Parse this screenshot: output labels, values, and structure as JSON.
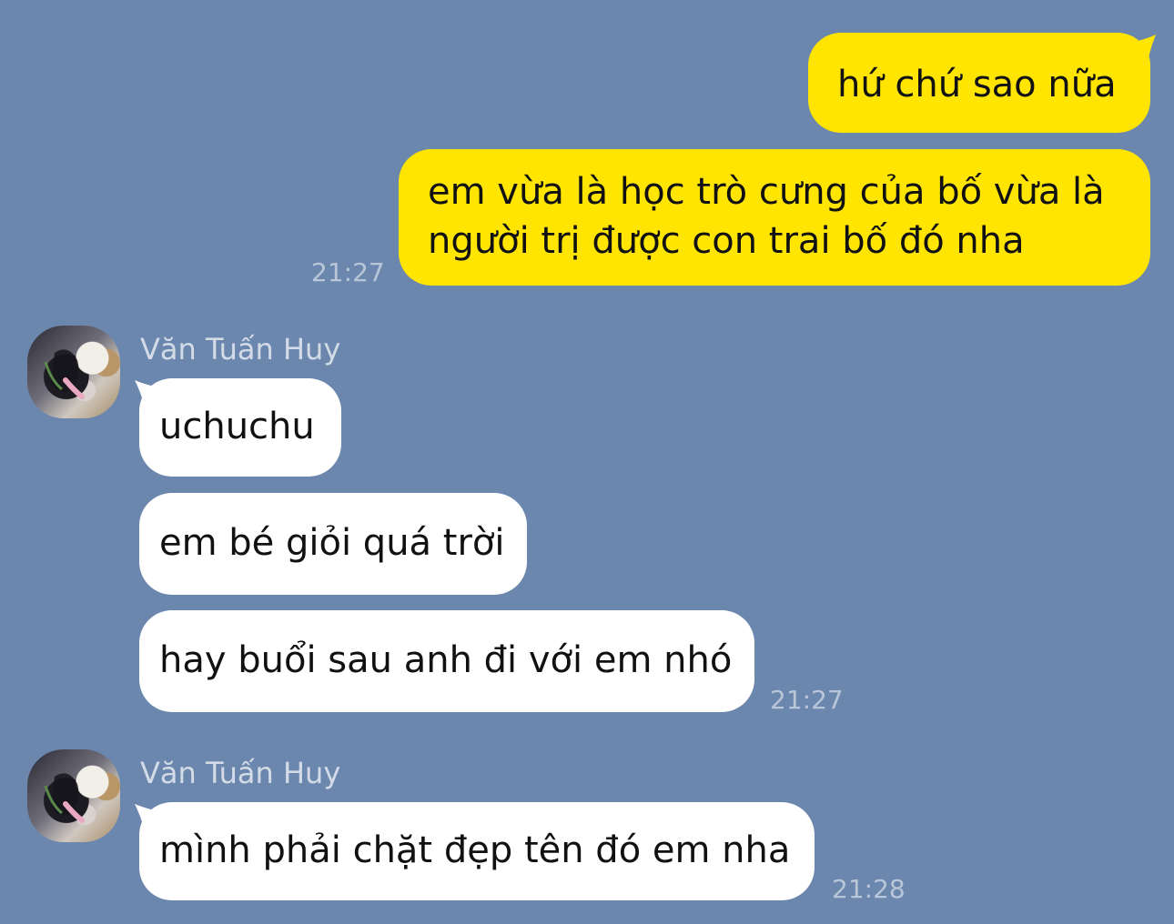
{
  "chat": {
    "messages_outgoing": [
      {
        "text": "hứ chứ sao nữa"
      },
      {
        "lines": [
          "em vừa là học trò cưng của bố vừa là",
          "người trị được con trai bố đó nha"
        ],
        "time": "21:27"
      }
    ],
    "group1": {
      "sender": "Văn Tuấn Huy",
      "messages": [
        {
          "text": "uchuchu"
        },
        {
          "text": "em bé giỏi quá trời"
        },
        {
          "text": "hay buổi sau anh đi với em nhó",
          "time": "21:27"
        }
      ]
    },
    "group2": {
      "sender": "Văn Tuấn Huy",
      "messages": [
        {
          "text": "mình phải chặt đẹp tên đó em nha",
          "time": "21:28"
        }
      ]
    }
  },
  "colors": {
    "background": "#6b87ae",
    "outgoing_bubble": "#ffe501",
    "incoming_bubble": "#ffffff",
    "timestamp": "#b9c6d8",
    "sender_name": "#d3dbe7"
  },
  "icons": {
    "avatar": "cat-photo-avatar"
  }
}
